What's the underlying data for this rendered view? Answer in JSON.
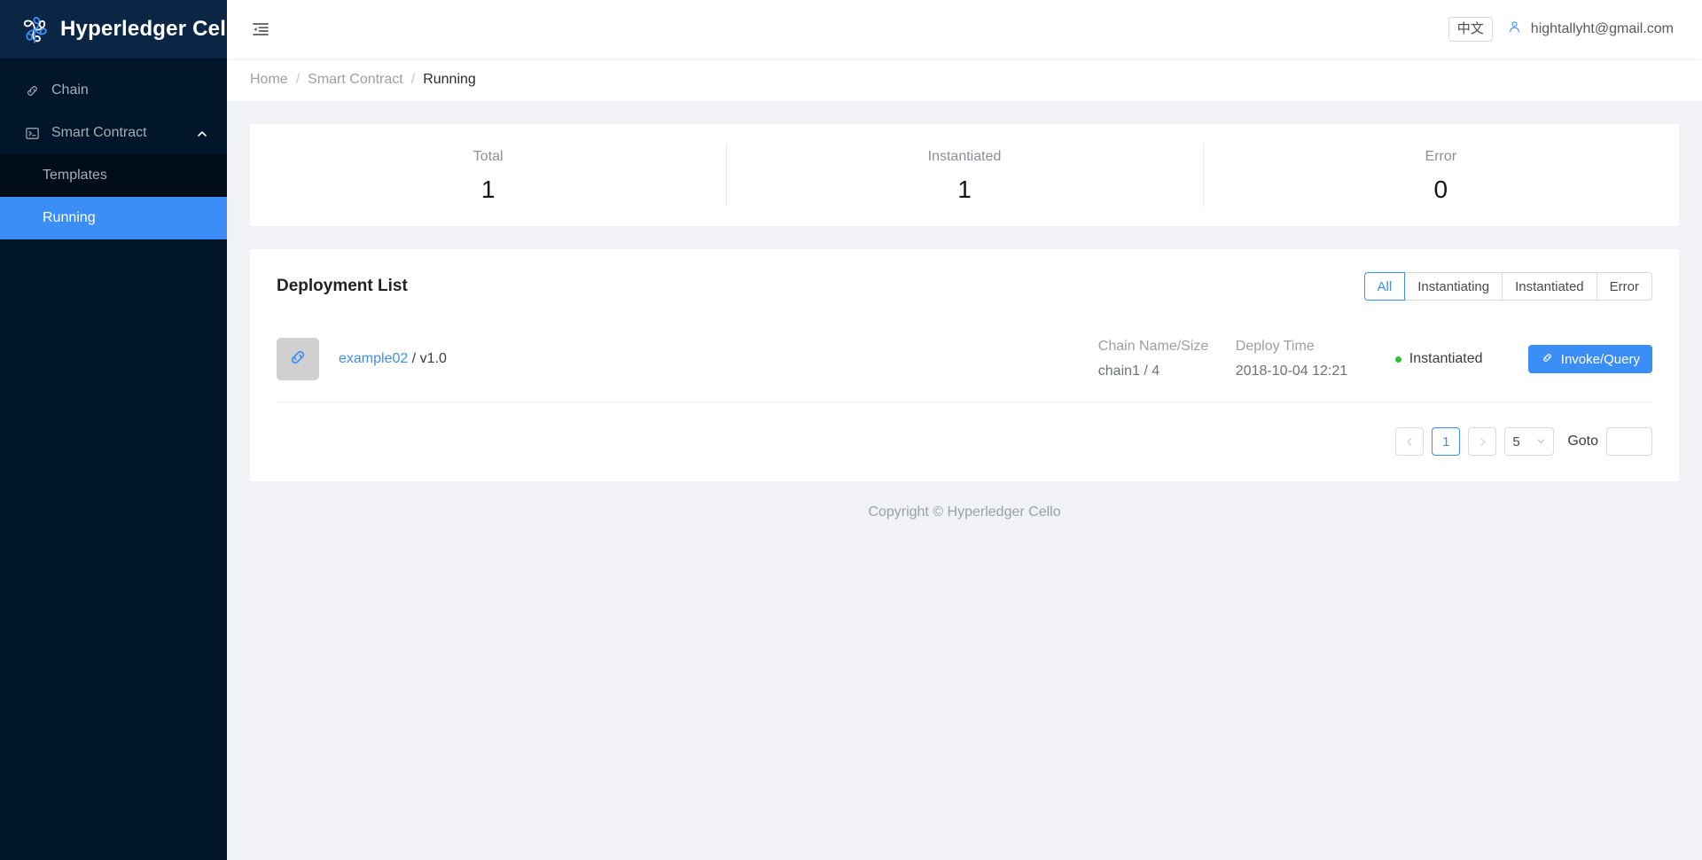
{
  "brand": {
    "title": "Hyperledger Cello",
    "logo_icon": "cello-flower-logo"
  },
  "sidebar": {
    "items": [
      {
        "label": "Chain",
        "icon": "link-icon"
      },
      {
        "label": "Smart Contract",
        "icon": "code-terminal-icon",
        "arrow_icon": "chevron-up-icon"
      }
    ],
    "submenu": [
      {
        "label": "Templates",
        "active": false
      },
      {
        "label": "Running",
        "active": true
      }
    ]
  },
  "topbar": {
    "fold_icon": "menu-fold-icon",
    "lang_label": "中文",
    "user_icon": "user-icon",
    "user_email": "hightallyht@gmail.com"
  },
  "breadcrumb": {
    "items": [
      "Home",
      "Smart Contract",
      "Running"
    ],
    "separator": "/"
  },
  "stats": [
    {
      "label": "Total",
      "value": "1"
    },
    {
      "label": "Instantiated",
      "value": "1"
    },
    {
      "label": "Error",
      "value": "0"
    }
  ],
  "list": {
    "title": "Deployment List",
    "filters": [
      {
        "label": "All",
        "active": true
      },
      {
        "label": "Instantiating",
        "active": false
      },
      {
        "label": "Instantiated",
        "active": false
      },
      {
        "label": "Error",
        "active": false
      }
    ],
    "rows": [
      {
        "avatar_icon": "chain-link-icon",
        "name": "example02",
        "version": "/ v1.0",
        "chain_label": "Chain Name/Size",
        "chain_value": "chain1 / 4",
        "deploy_label": "Deploy Time",
        "deploy_value": "2018-10-04 12:21",
        "status": "Instantiated",
        "status_color": "#30c030",
        "action_label": "Invoke/Query",
        "action_icon": "link-icon"
      }
    ]
  },
  "pagination": {
    "prev_icon": "chevron-left-icon",
    "next_icon": "chevron-right-icon",
    "current_page": "1",
    "page_size": "5",
    "page_size_caret_icon": "chevron-down-icon",
    "goto_label": "Goto",
    "goto_value": "",
    "goto_placeholder": ""
  },
  "footer": {
    "text": "Copyright © Hyperledger Cello"
  },
  "colors": {
    "accent": "#3a8ef6",
    "sidebar_bg": "#001529",
    "brand_bg": "#0b2545",
    "content_bg": "#f0f2f5",
    "status_green": "#30c030"
  }
}
